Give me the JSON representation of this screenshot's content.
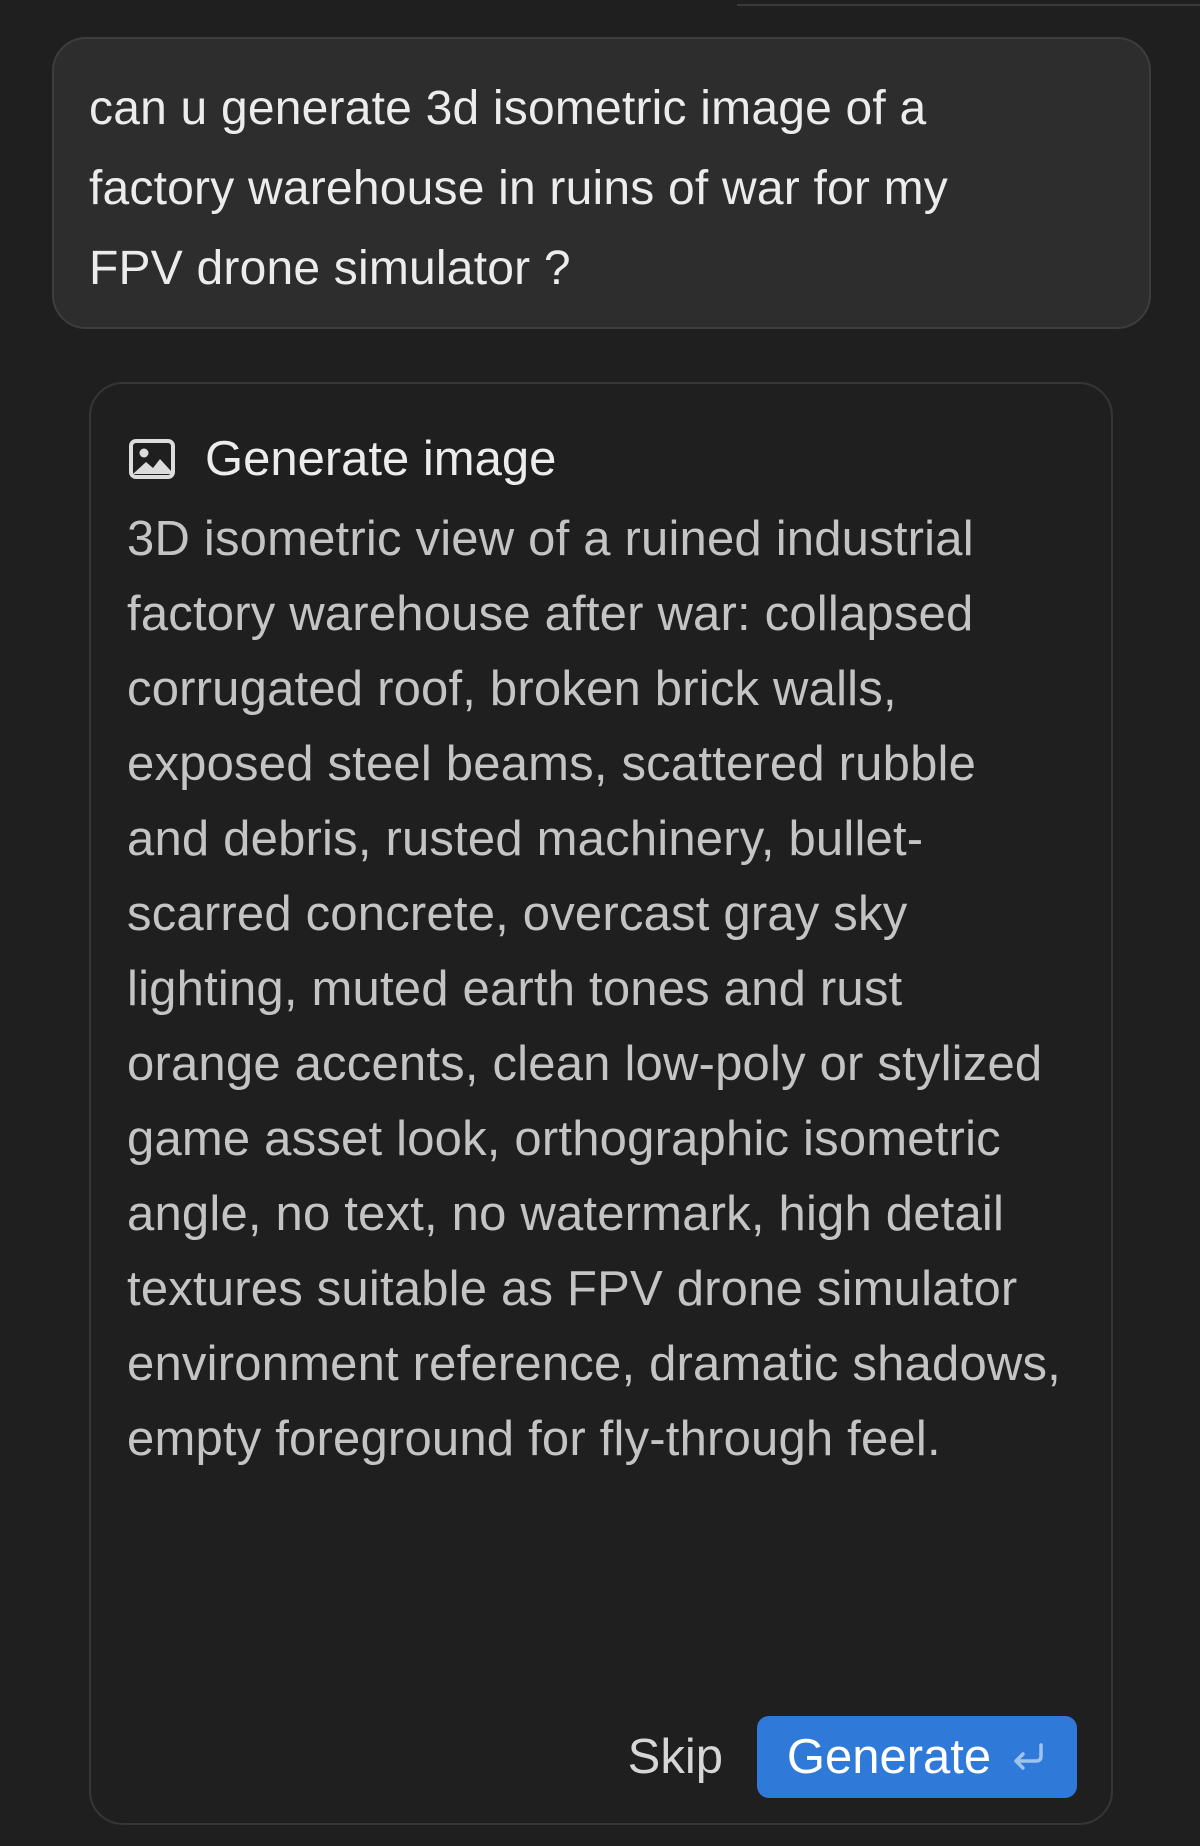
{
  "user_message": {
    "text": "can u generate 3d isometric image of a factory warehouse in ruins of war for my FPV drone simulator ?"
  },
  "generate_card": {
    "icon": "image-icon",
    "title": "Generate image",
    "prompt": "3D isometric view of a ruined industrial factory warehouse after war: collapsed corrugated roof, broken brick walls, exposed steel beams, scattered rubble and debris, rusted machinery, bullet-scarred concrete, overcast gray sky lighting, muted earth tones and rust orange accents, clean low-poly or stylized game asset look, orthographic isometric angle, no text, no watermark, high detail textures suitable as FPV drone simulator environment reference, dramatic shadows, empty foreground for fly-through feel.",
    "skip_label": "Skip",
    "generate_label": "Generate",
    "generate_icon": "return-icon"
  },
  "colors": {
    "background": "#1f1f1f",
    "bubble": "#2d2d2d",
    "accent": "#2f7ad8"
  }
}
